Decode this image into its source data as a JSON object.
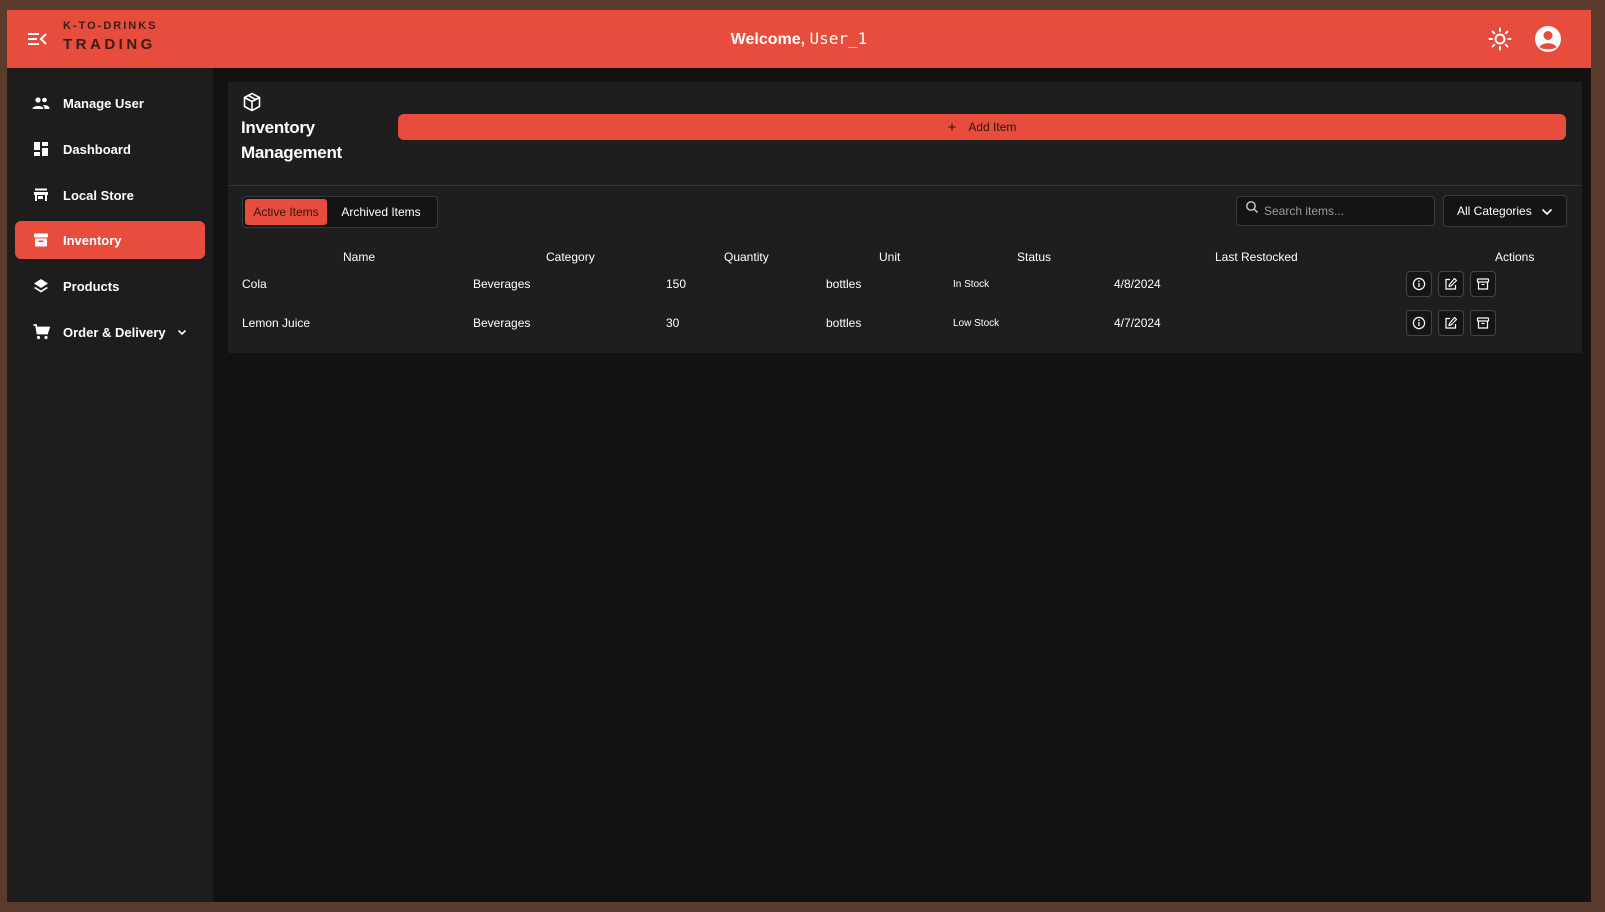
{
  "header": {
    "brand_top": "K-TO-DRINKS",
    "brand_bottom": "TRADING",
    "welcome_prefix": "Welcome, ",
    "welcome_user": "User_1",
    "menu_icon": "menu-collapse-icon",
    "theme_icon": "sun-icon",
    "profile_icon": "account-circle-icon"
  },
  "sidebar": {
    "items": [
      {
        "label": "Manage User",
        "icon": "users-icon"
      },
      {
        "label": "Dashboard",
        "icon": "dashboard-icon"
      },
      {
        "label": "Local Store",
        "icon": "store-icon"
      },
      {
        "label": "Inventory",
        "icon": "archive-box-icon",
        "active": true
      },
      {
        "label": "Products",
        "icon": "layers-icon"
      },
      {
        "label": "Order & Delivery",
        "icon": "cart-icon",
        "has_submenu": true
      }
    ]
  },
  "inventory": {
    "title_line1": "Inventory",
    "title_line2": "Management",
    "add_button": "Add Item",
    "tabs": [
      "Active Items",
      "Archived Items"
    ],
    "active_tab": "Active Items",
    "search_placeholder": "Search items...",
    "category_filter": "All Categories",
    "columns": [
      "Name",
      "Category",
      "Quantity",
      "Unit",
      "Status",
      "Last Restocked",
      "Actions"
    ],
    "rows": [
      {
        "name": "Cola",
        "category": "Beverages",
        "quantity": "150",
        "unit": "bottles",
        "status": "In Stock",
        "last_restocked": "4/8/2024"
      },
      {
        "name": "Lemon Juice",
        "category": "Beverages",
        "quantity": "30",
        "unit": "bottles",
        "status": "Low Stock",
        "last_restocked": "4/7/2024"
      }
    ],
    "row_actions": [
      "info-icon",
      "edit-icon",
      "archive-icon"
    ]
  },
  "colors": {
    "accent": "#e84c3d",
    "background": "#121212",
    "sidebar": "#1d1d1d",
    "panel": "#1e1e1e"
  }
}
